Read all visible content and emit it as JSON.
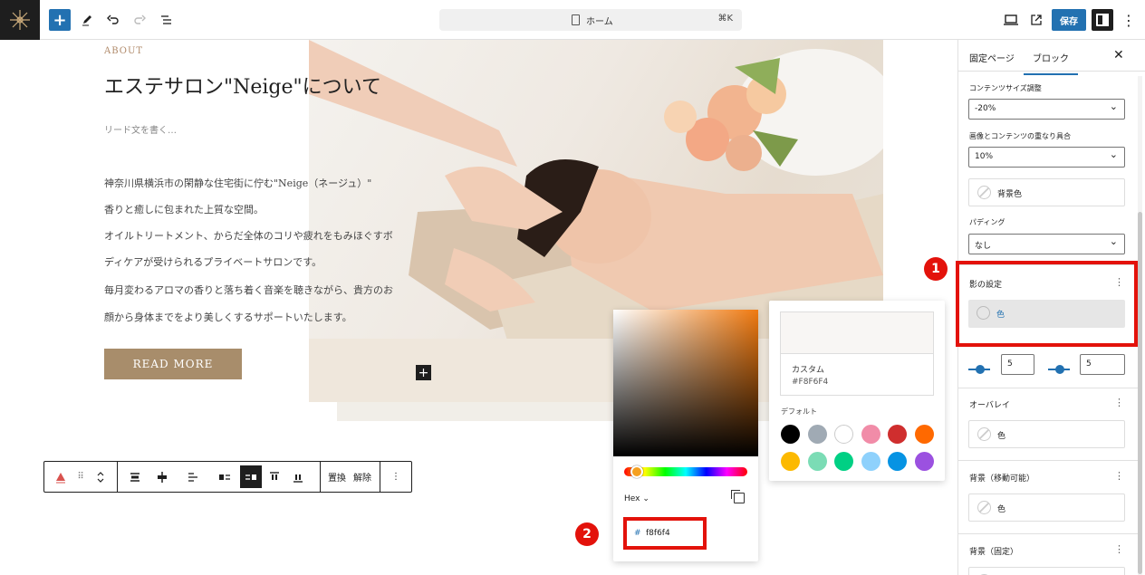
{
  "topbar": {
    "command_title": "ホーム",
    "shortcut": "⌘K",
    "save_label": "保存"
  },
  "content": {
    "eyebrow": "ABOUT",
    "heading": "エステサロン\"Neige\"について",
    "lead": "リード文を書く…",
    "paragraph_lines": [
      "神奈川県横浜市の閑静な住宅街に佇む\"Neige（ネージュ）\"",
      "香りと癒しに包まれた上質な空間。",
      "オイルトリートメント、からだ全体のコリや疲れをもみほぐすボ",
      "ディケアが受けられるプライベートサロンです。",
      "毎月変わるアロマの香りと落ち着く音楽を聴きながら、貴方のお",
      "顔から身体までをより美しくするサポートいたします。"
    ],
    "button_label": "READ MORE"
  },
  "block_toolbar": {
    "replace_label": "置換",
    "unlink_label": "解除"
  },
  "color_picker": {
    "format_label": "Hex",
    "hash": "#",
    "hex_value": "f8f6f4",
    "hue_color": "#f07a10"
  },
  "palette": {
    "custom_label": "カスタム",
    "custom_hex": "#F8F6F4",
    "custom_color": "#f8f6f4",
    "default_label": "デフォルト",
    "swatches": [
      "#000000",
      "#a0aab4",
      "#ffffff",
      "#f18ca8",
      "#cf2e2e",
      "#ff6900",
      "#fcb900",
      "#7bdcb5",
      "#00d084",
      "#8ed1fc",
      "#0693e3",
      "#9b51e0"
    ]
  },
  "sidebar": {
    "tab_page": "固定ページ",
    "tab_block": "ブロック",
    "content_size_label": "コンテンツサイズ調整",
    "content_size_value": "-20%",
    "overlap_label": "画像とコンテンツの重なり具合",
    "overlap_value": "10%",
    "bg_color_label": "背景色",
    "padding_label": "パディング",
    "padding_value": "なし",
    "shadow_title": "影の設定",
    "shadow_color_label": "色",
    "shadow_h_value": "5",
    "shadow_v_value": "5",
    "overlay_title": "オーバレイ",
    "overlay_color_label": "色",
    "bg_movable_title": "背景（移動可能）",
    "bg_movable_color_label": "色",
    "bg_fixed_title": "背景（固定）"
  },
  "annotations": [
    "1",
    "2"
  ]
}
